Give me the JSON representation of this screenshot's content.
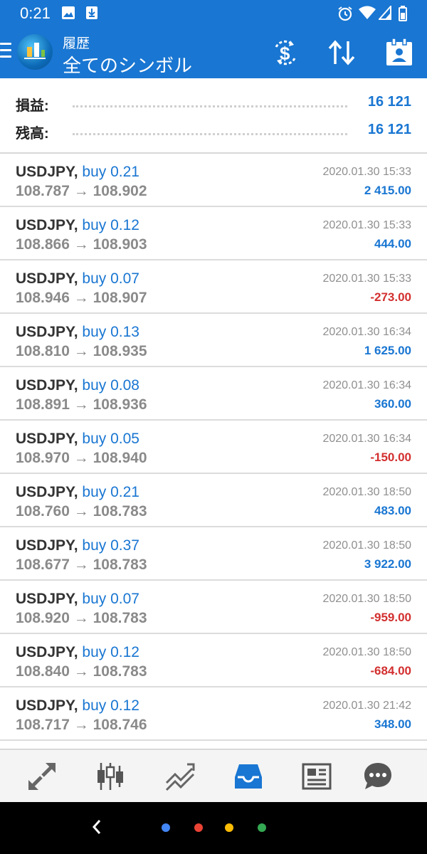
{
  "status_bar": {
    "time": "0:21",
    "icons": [
      "image-icon",
      "download-icon",
      "alarm-icon",
      "wifi-icon",
      "signal-icon",
      "battery-icon"
    ]
  },
  "app_bar": {
    "subtitle": "履歴",
    "title": "全てのシンボル",
    "actions": [
      "currency-exchange-icon",
      "sort-icon",
      "calendar-icon"
    ]
  },
  "summary": {
    "profit_label": "損益:",
    "profit_value": "16 121",
    "balance_label": "残高:",
    "balance_value": "16 121"
  },
  "trades": [
    {
      "symbol": "USDJPY,",
      "side": "buy 0.21",
      "open": "108.787",
      "arrow": "→",
      "close": "108.902",
      "datetime": "2020.01.30 15:33",
      "profit": "2 415.00",
      "sign": "pos"
    },
    {
      "symbol": "USDJPY,",
      "side": "buy 0.12",
      "open": "108.866",
      "arrow": "→",
      "close": "108.903",
      "datetime": "2020.01.30 15:33",
      "profit": "444.00",
      "sign": "pos"
    },
    {
      "symbol": "USDJPY,",
      "side": "buy 0.07",
      "open": "108.946",
      "arrow": "→",
      "close": "108.907",
      "datetime": "2020.01.30 15:33",
      "profit": "-273.00",
      "sign": "neg"
    },
    {
      "symbol": "USDJPY,",
      "side": "buy 0.13",
      "open": "108.810",
      "arrow": "→",
      "close": "108.935",
      "datetime": "2020.01.30 16:34",
      "profit": "1 625.00",
      "sign": "pos"
    },
    {
      "symbol": "USDJPY,",
      "side": "buy 0.08",
      "open": "108.891",
      "arrow": "→",
      "close": "108.936",
      "datetime": "2020.01.30 16:34",
      "profit": "360.00",
      "sign": "pos"
    },
    {
      "symbol": "USDJPY,",
      "side": "buy 0.05",
      "open": "108.970",
      "arrow": "→",
      "close": "108.940",
      "datetime": "2020.01.30 16:34",
      "profit": "-150.00",
      "sign": "neg"
    },
    {
      "symbol": "USDJPY,",
      "side": "buy 0.21",
      "open": "108.760",
      "arrow": "→",
      "close": "108.783",
      "datetime": "2020.01.30 18:50",
      "profit": "483.00",
      "sign": "pos"
    },
    {
      "symbol": "USDJPY,",
      "side": "buy 0.37",
      "open": "108.677",
      "arrow": "→",
      "close": "108.783",
      "datetime": "2020.01.30 18:50",
      "profit": "3 922.00",
      "sign": "pos"
    },
    {
      "symbol": "USDJPY,",
      "side": "buy 0.07",
      "open": "108.920",
      "arrow": "→",
      "close": "108.783",
      "datetime": "2020.01.30 18:50",
      "profit": "-959.00",
      "sign": "neg"
    },
    {
      "symbol": "USDJPY,",
      "side": "buy 0.12",
      "open": "108.840",
      "arrow": "→",
      "close": "108.783",
      "datetime": "2020.01.30 18:50",
      "profit": "-684.00",
      "sign": "neg"
    },
    {
      "symbol": "USDJPY,",
      "side": "buy 0.12",
      "open": "108.717",
      "arrow": "→",
      "close": "108.746",
      "datetime": "2020.01.30 21:42",
      "profit": "348.00",
      "sign": "pos"
    }
  ],
  "bottom_nav": {
    "items": [
      "quotes-icon",
      "chart-icon",
      "trade-icon",
      "history-icon",
      "news-icon",
      "messages-icon"
    ],
    "active": "history-icon"
  },
  "colors": {
    "accent": "#1976d2",
    "negative": "#d32f2f",
    "google_dots": [
      "#4285f4",
      "#ea4335",
      "#fbbc05",
      "#34a853"
    ]
  }
}
